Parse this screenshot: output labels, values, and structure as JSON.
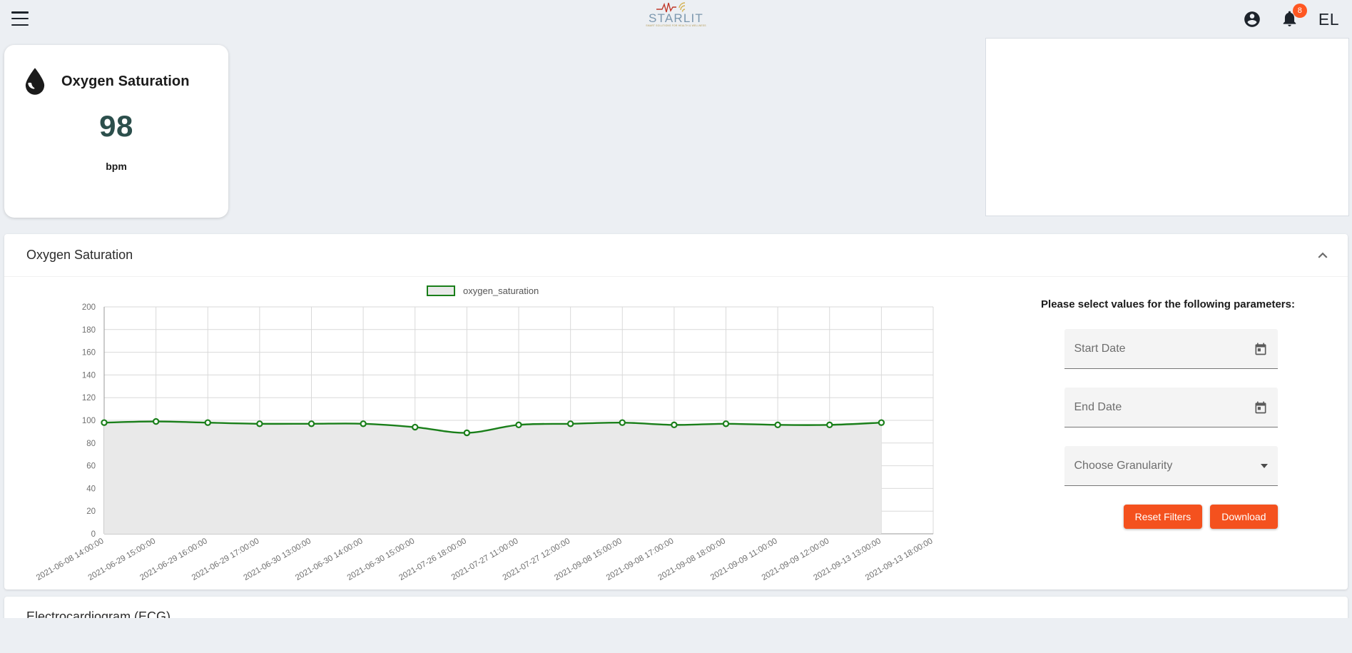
{
  "appbar": {
    "menu_icon": "hamburger-menu-icon",
    "logo_word": "STARLIT",
    "logo_tagline": "SMART SOLUTIONS FOR HEALTH & WELLNESS",
    "account_icon": "account-circle-icon",
    "notifications_icon": "bell-icon",
    "notification_count": "8",
    "user_initials": "EL",
    "accent_orange": "#ff5722"
  },
  "kpi_card": {
    "icon": "blood-drop-icon",
    "title": "Oxygen Saturation",
    "value": "98",
    "unit": "bpm",
    "value_color": "#2c4f4c"
  },
  "section": {
    "title": "Oxygen Saturation",
    "collapse_icon": "chevron-up-icon"
  },
  "filters": {
    "heading": "Please select values for the following parameters:",
    "start_date": {
      "label": "Start Date",
      "value": "",
      "icon": "calendar-icon"
    },
    "end_date": {
      "label": "End Date",
      "value": "",
      "icon": "calendar-icon"
    },
    "granularity": {
      "label": "Choose Granularity",
      "value": "",
      "icon": "chevron-down-icon"
    },
    "reset_label": "Reset Filters",
    "download_label": "Download",
    "button_color": "#f4511e"
  },
  "next_section": {
    "title": "Electrocardiogram (ECG)"
  },
  "chart_data": {
    "type": "line",
    "title": "",
    "xlabel": "",
    "ylabel": "",
    "ylim": [
      0,
      200
    ],
    "yticks": [
      0,
      20,
      40,
      60,
      80,
      100,
      120,
      140,
      160,
      180,
      200
    ],
    "grid": true,
    "legend_position": "top-center",
    "line_color": "#1a7f1a",
    "area_fill": "#e9e9e9",
    "series": [
      {
        "name": "oxygen_saturation",
        "values": [
          98,
          99,
          98,
          97,
          97,
          97,
          94,
          89,
          96,
          97,
          98,
          96,
          97,
          96,
          96,
          98
        ]
      }
    ],
    "categories": [
      "2021-06-08 14:00:00",
      "2021-06-29 15:00:00",
      "2021-06-29 16:00:00",
      "2021-06-29 17:00:00",
      "2021-06-30 13:00:00",
      "2021-06-30 14:00:00",
      "2021-06-30 15:00:00",
      "2021-07-26 18:00:00",
      "2021-07-27 11:00:00",
      "2021-07-27 12:00:00",
      "2021-09-08 15:00:00",
      "2021-09-08 17:00:00",
      "2021-09-08 18:00:00",
      "2021-09-09 11:00:00",
      "2021-09-09 12:00:00",
      "2021-09-13 13:00:00",
      "2021-09-13 18:00:00"
    ]
  }
}
